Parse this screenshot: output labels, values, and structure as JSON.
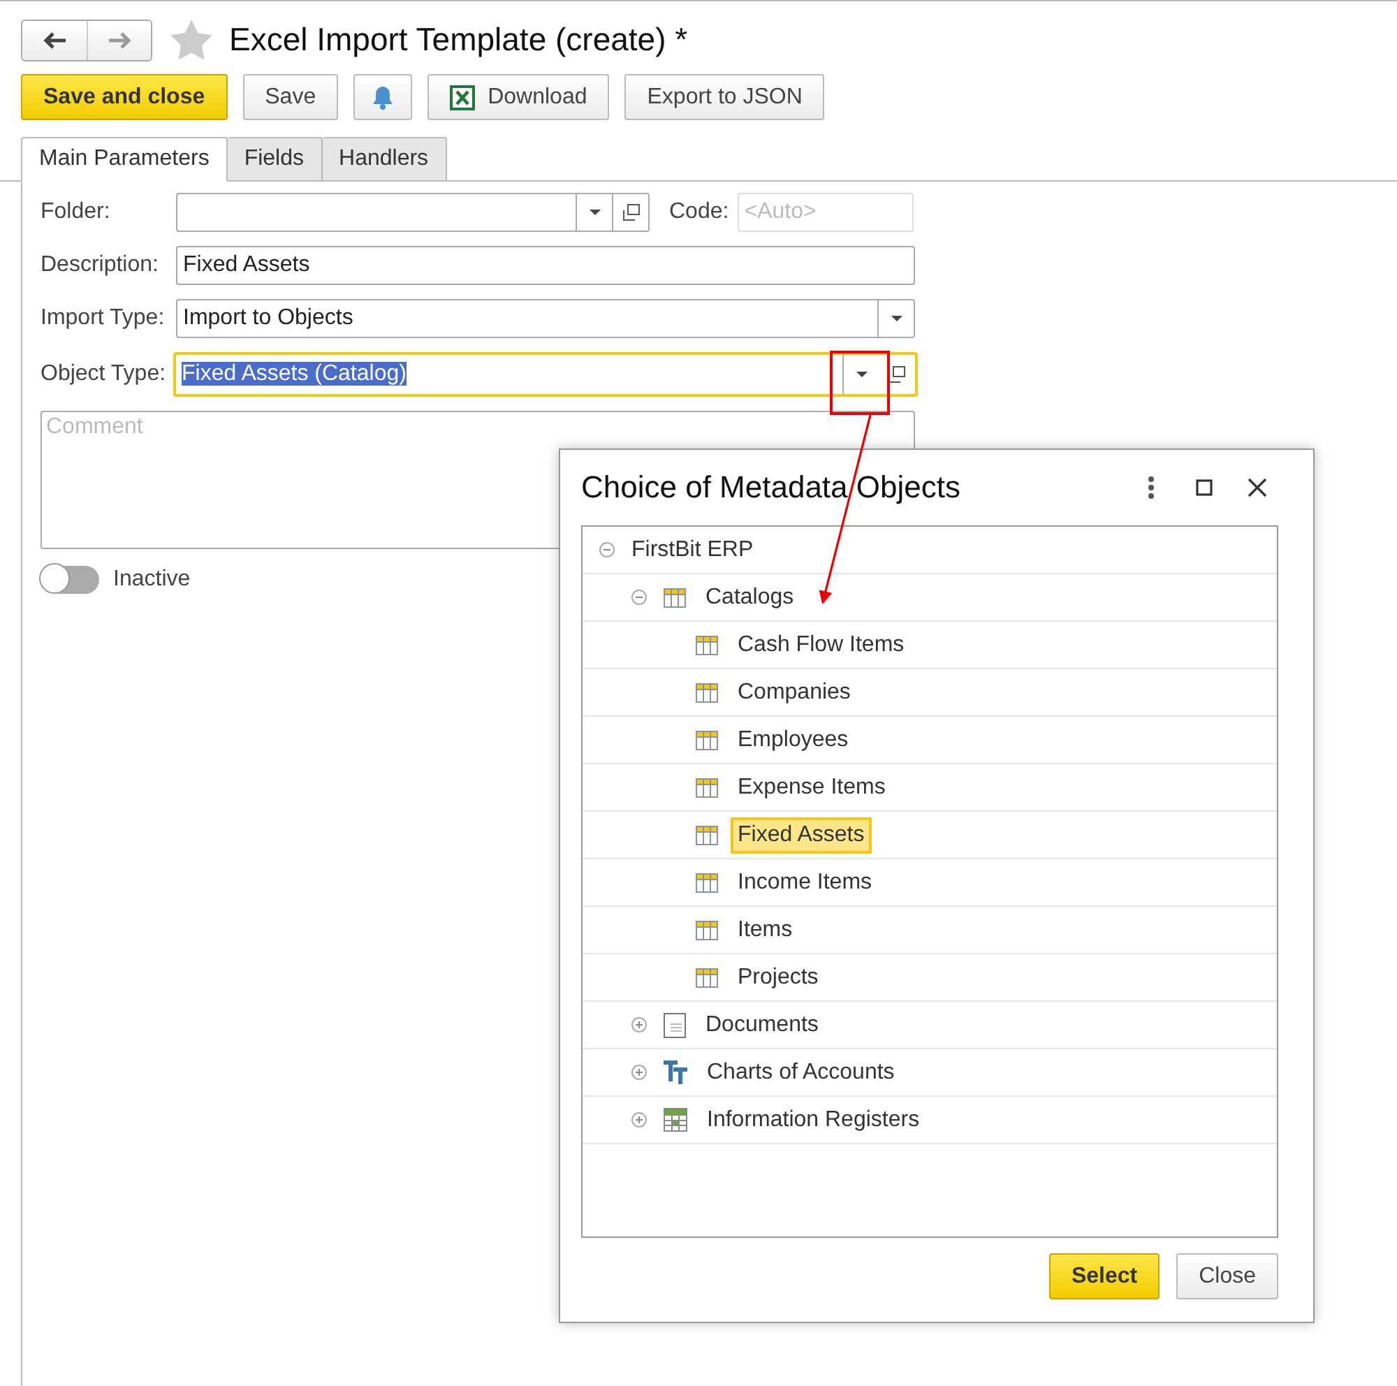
{
  "title": "Excel Import Template (create) *",
  "toolbar": [
    {
      "kind": "primary",
      "label": "Save and close"
    },
    {
      "kind": "plain",
      "label": "Save"
    },
    {
      "kind": "bell"
    },
    {
      "kind": "excel",
      "label": "Download"
    },
    {
      "kind": "plain",
      "label": "Export to JSON"
    }
  ],
  "tabs": [
    {
      "label": "Main Parameters",
      "selected": true
    },
    {
      "label": "Fields",
      "selected": false
    },
    {
      "label": "Handlers",
      "selected": false
    }
  ],
  "form": {
    "folder": {
      "label": "Folder:"
    },
    "code": {
      "label": "Code:",
      "placeholder": "<Auto>"
    },
    "description": {
      "label": "Description:",
      "value": "Fixed Assets"
    },
    "import_type": {
      "label": "Import Type:",
      "value": "Import to Objects"
    },
    "object_type": {
      "label": "Object Type:",
      "value": "Fixed Assets (Catalog)",
      "focused": true,
      "text_selected": true
    },
    "comment": {
      "placeholder": "Comment"
    },
    "inactive": {
      "label": "Inactive",
      "on": false
    }
  },
  "dialog": {
    "title": "Choice of Metadata Objects",
    "tree": [
      {
        "label": "FirstBit ERP",
        "expanded": true,
        "selected": false,
        "children": [
          {
            "label": "Catalogs",
            "kind": "catalogs",
            "expanded": true,
            "selected": false,
            "children": [
              {
                "label": "Cash Flow Items",
                "kind": "catalog",
                "selected": false
              },
              {
                "label": "Companies",
                "kind": "catalog",
                "selected": false
              },
              {
                "label": "Employees",
                "kind": "catalog",
                "selected": false
              },
              {
                "label": "Expense Items",
                "kind": "catalog",
                "selected": false
              },
              {
                "label": "Fixed Assets",
                "kind": "catalog",
                "selected": true
              },
              {
                "label": "Income Items",
                "kind": "catalog",
                "selected": false
              },
              {
                "label": "Items",
                "kind": "catalog",
                "selected": false
              },
              {
                "label": "Projects",
                "kind": "catalog",
                "selected": false
              }
            ]
          },
          {
            "label": "Documents",
            "kind": "documents",
            "expanded": false,
            "selected": false
          },
          {
            "label": "Charts of Accounts",
            "kind": "charts",
            "expanded": false,
            "selected": false
          },
          {
            "label": "Information Registers",
            "kind": "registers",
            "expanded": false,
            "selected": false
          }
        ]
      }
    ],
    "buttons": [
      {
        "kind": "primary",
        "label": "Select"
      },
      {
        "kind": "plain",
        "label": "Close"
      }
    ]
  }
}
